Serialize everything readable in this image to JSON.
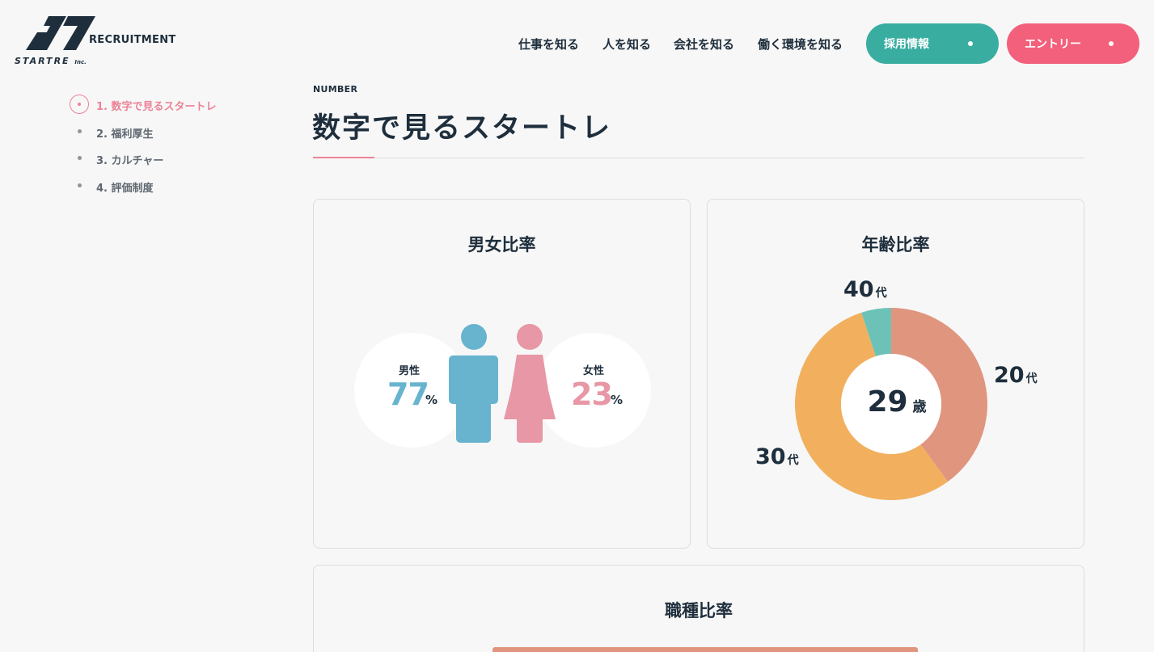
{
  "header": {
    "brand_name": "STARTRE",
    "brand_suffix": "Inc.",
    "site_label": "RECRUITMENT",
    "nav": [
      "仕事を知る",
      "人を知る",
      "会社を知る",
      "働く環境を知る"
    ],
    "recruit_button": "採用情報",
    "entry_button": "エントリー"
  },
  "sidebar": {
    "items": [
      {
        "label": "1. 数字で見るスタートレ",
        "active": true
      },
      {
        "label": "2. 福利厚生",
        "active": false
      },
      {
        "label": "3. カルチャー",
        "active": false
      },
      {
        "label": "4. 評価制度",
        "active": false
      }
    ]
  },
  "section": {
    "eyebrow": "NUMBER",
    "title": "数字で見るスタートレ"
  },
  "gender": {
    "title": "男女比率",
    "male_label": "男性",
    "male_value": "77",
    "female_label": "女性",
    "female_value": "23",
    "unit": "%"
  },
  "age": {
    "title": "年齢比率",
    "average": "29",
    "average_unit": "歳",
    "suffix": "代",
    "labels": [
      "40",
      "20",
      "30"
    ]
  },
  "job": {
    "title": "職種比率"
  },
  "colors": {
    "male": "#68b4cf",
    "female": "#e797a5",
    "teal": "#3aada1",
    "pink": "#f2607b",
    "age20": "#e0957e",
    "age30": "#f2b05e",
    "age40": "#6dc2b8"
  },
  "chart_data": {
    "type": "pie",
    "title": "年齢比率",
    "categories": [
      "20代",
      "30代",
      "40代"
    ],
    "values": [
      40,
      55,
      5
    ]
  }
}
